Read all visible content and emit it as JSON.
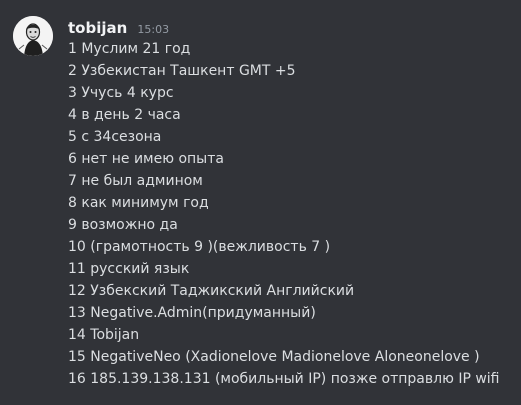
{
  "message": {
    "author": "tobijan",
    "timestamp": "15:03",
    "avatar_icon": "user-avatar-icon",
    "lines": [
      "1 Муслим 21 год",
      "2 Узбекистан Ташкент GMT +5",
      "3 Учусь 4 курс",
      "4 в день 2 часа",
      "5 с 34сезона",
      "6 нет не имею опыта",
      "7 не был админом",
      "8 как минимум год",
      "9 возможно да",
      "10 (грамотность 9 )(вежливость 7 )",
      "11 русский язык",
      "12 Узбекский Таджикский Английский",
      "13 Negative.Admin(придуманный)",
      "14 Tobijan",
      "15 NegativeNeo (Xadionelove Madionelove Aloneonelove )",
      "16 185.139.138.131 (мобильный IP) позже отправлю IP wifi"
    ]
  },
  "colors": {
    "background": "#313338",
    "username": "#f2f3f5",
    "timestamp": "#949ba4",
    "text": "#dbdee1"
  }
}
